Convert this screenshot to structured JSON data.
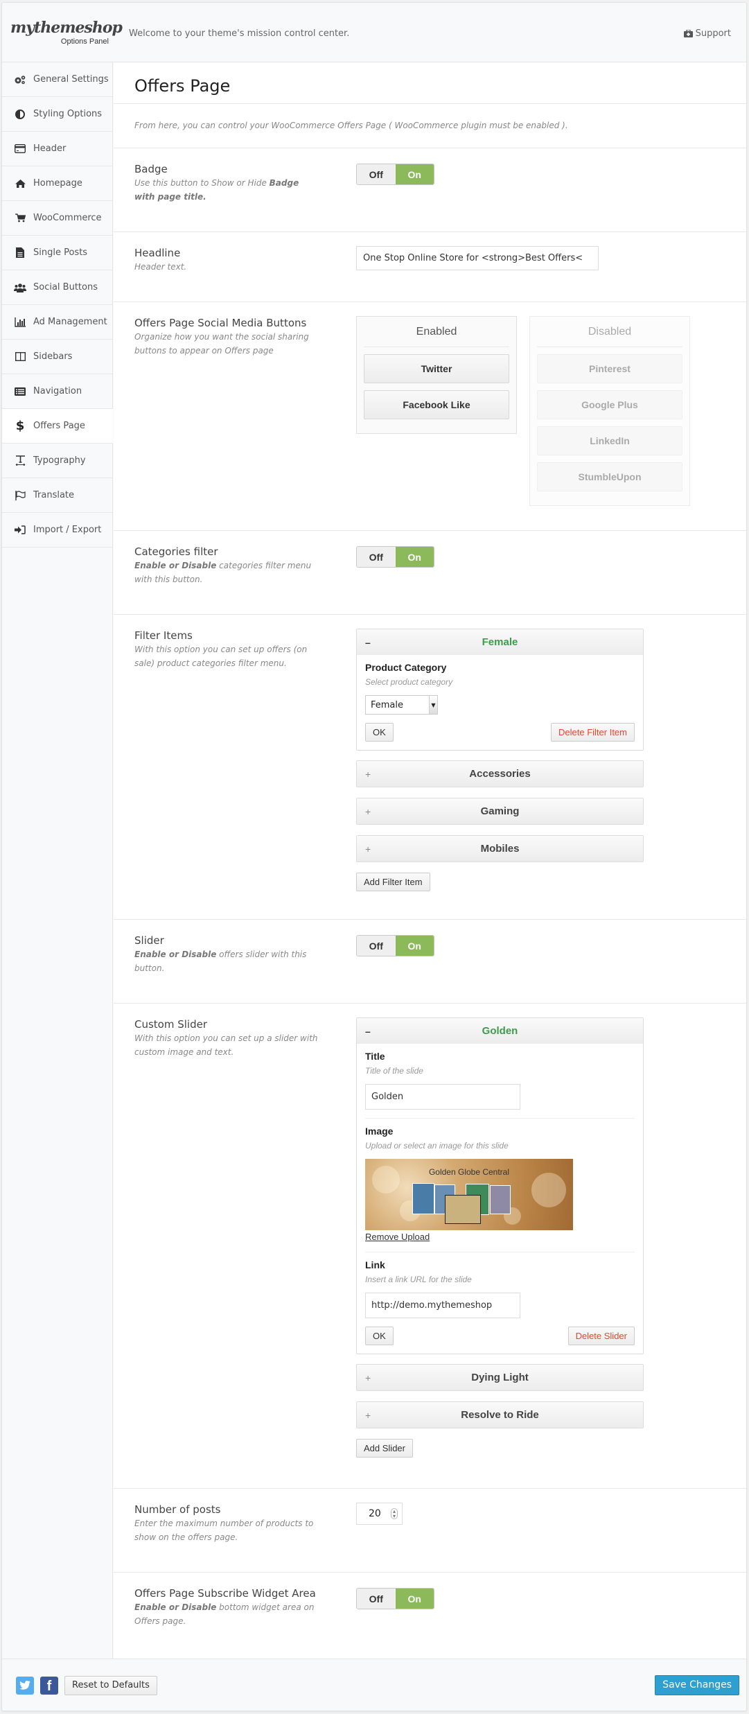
{
  "header": {
    "logo": "mythemeshop",
    "logo_sub": "Options Panel",
    "welcome": "Welcome to your theme's mission control center.",
    "support_label": "Support"
  },
  "sidebar": {
    "items": [
      {
        "label": "General Settings",
        "icon": "gears-icon"
      },
      {
        "label": "Styling Options",
        "icon": "adjust-icon"
      },
      {
        "label": "Header",
        "icon": "credit-card-icon"
      },
      {
        "label": "Homepage",
        "icon": "home-icon"
      },
      {
        "label": "WooCommerce",
        "icon": "cart-icon"
      },
      {
        "label": "Single Posts",
        "icon": "file-icon"
      },
      {
        "label": "Social Buttons",
        "icon": "users-icon"
      },
      {
        "label": "Ad Management",
        "icon": "bar-chart-icon"
      },
      {
        "label": "Sidebars",
        "icon": "columns-icon"
      },
      {
        "label": "Navigation",
        "icon": "list-alt-icon"
      },
      {
        "label": "Offers Page",
        "icon": "dollar-icon",
        "active": true
      },
      {
        "label": "Typography",
        "icon": "text-width-icon"
      },
      {
        "label": "Translate",
        "icon": "flag-icon"
      },
      {
        "label": "Import / Export",
        "icon": "sign-in-icon"
      }
    ]
  },
  "main": {
    "title": "Offers Page",
    "intro": "From here, you can control your WooCommerce Offers Page ( WooCommerce plugin must be enabled ).",
    "badge": {
      "title": "Badge",
      "desc_pre": "Use this button to Show or Hide ",
      "desc_bold": "Badge with page title.",
      "off": "Off",
      "on": "On",
      "value": "On"
    },
    "headline": {
      "title": "Headline",
      "desc": "Header text.",
      "value": "One Stop Online Store for <strong>Best Offers<"
    },
    "social": {
      "title": "Offers Page Social Media Buttons",
      "desc": "Organize how you want the social sharing buttons to appear on Offers page",
      "enabled_label": "Enabled",
      "disabled_label": "Disabled",
      "enabled": [
        "Twitter",
        "Facebook Like"
      ],
      "disabled": [
        "Pinterest",
        "Google Plus",
        "LinkedIn",
        "StumbleUpon"
      ]
    },
    "categories_filter": {
      "title": "Categories filter",
      "desc_bold": "Enable or Disable",
      "desc_rest": " categories filter menu with this button.",
      "off": "Off",
      "on": "On",
      "value": "On"
    },
    "filter_items": {
      "title": "Filter Items",
      "desc": "With this option you can set up offers (on sale) product categories filter menu.",
      "open_item": {
        "title": "Female",
        "field_label": "Product Category",
        "field_desc": "Select product category",
        "selected": "Female",
        "ok": "OK",
        "delete": "Delete Filter Item"
      },
      "collapsed": [
        "Accessories",
        "Gaming",
        "Mobiles"
      ],
      "add_label": "Add Filter Item"
    },
    "slider": {
      "title": "Slider",
      "desc_bold": "Enable or Disable",
      "desc_rest": " offers slider with this button.",
      "off": "Off",
      "on": "On",
      "value": "On"
    },
    "custom_slider": {
      "title": "Custom Slider",
      "desc": "With this option you can set up a slider with custom image and text.",
      "open_item": {
        "title": "Golden",
        "title_label": "Title",
        "title_desc": "Title of the slide",
        "title_value": "Golden",
        "image_label": "Image",
        "image_desc": "Upload or select an image for this slide",
        "image_caption": "Golden Globe Central",
        "remove_upload": "Remove Upload",
        "link_label": "Link",
        "link_desc": "Insert a link URL for the slide",
        "link_value": "http://demo.mythemeshop",
        "ok": "OK",
        "delete": "Delete Slider"
      },
      "collapsed": [
        "Dying Light",
        "Resolve to Ride"
      ],
      "add_label": "Add Slider"
    },
    "num_posts": {
      "title": "Number of posts",
      "desc": "Enter the maximum number of products to show on the offers page.",
      "value": "20"
    },
    "subscribe": {
      "title": "Offers Page Subscribe Widget Area",
      "desc_bold": "Enable or Disable",
      "desc_rest": " bottom widget area on Offers page.",
      "off": "Off",
      "on": "On",
      "value": "On"
    }
  },
  "footer": {
    "twitter_color": "#55acee",
    "facebook_color": "#3b5998",
    "reset_label": "Reset to Defaults",
    "save_label": "Save Changes"
  },
  "colors": {
    "toggle_on": "#8cba5a",
    "accent_green": "#3c9c4b",
    "danger": "#e8452c",
    "primary": "#2d9fd0"
  }
}
